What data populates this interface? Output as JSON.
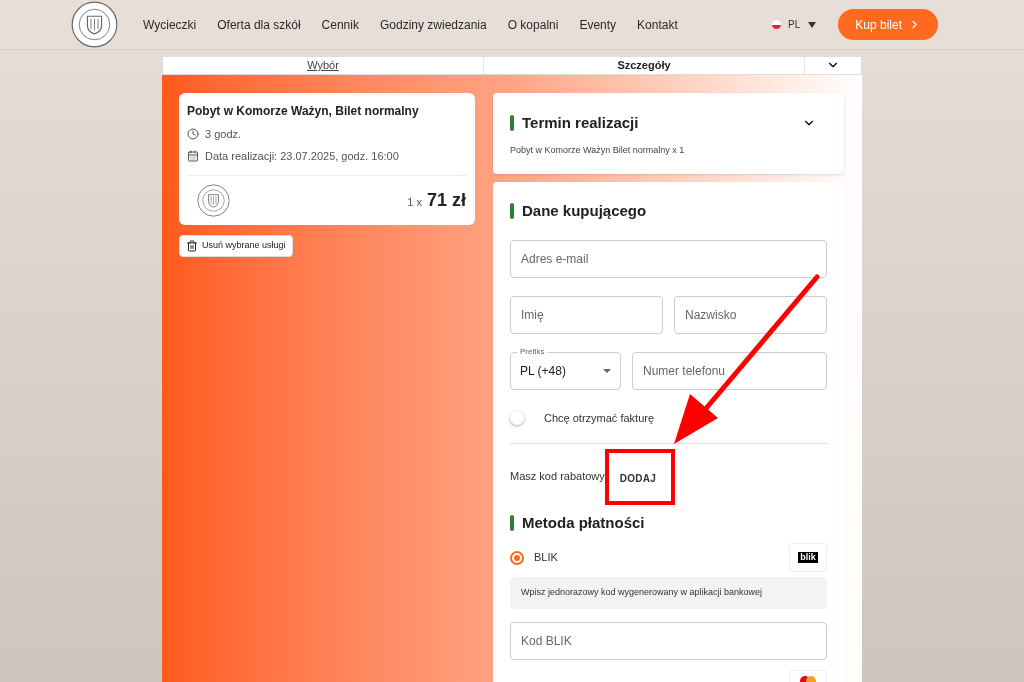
{
  "header": {
    "nav": [
      "Wycieczki",
      "Oferta dla szkół",
      "Cennik",
      "Godziny zwiedzania",
      "O kopalni",
      "Eventy",
      "Kontakt"
    ],
    "language": "PL",
    "cta": "Kup bilet"
  },
  "steps": [
    {
      "label": "Wybór",
      "selected": false
    },
    {
      "label": "Szczegóły",
      "selected": true
    }
  ],
  "cart": {
    "title": "Pobyt w Komorze Ważyn, Bilet normalny",
    "duration": "3 godz.",
    "date": "Data realizacji: 23.07.2025, godz. 16:00",
    "quantity": "1 x",
    "price": "71 zł",
    "remove_button": "Usuń wybrane usługi"
  },
  "term": {
    "title": "Termin realizacji",
    "summary": "Pobyt w Komorze Ważyn Bilet normalny x 1",
    "expanded": false
  },
  "buyer": {
    "title": "Dane kupującego",
    "email": {
      "placeholder": "Adres e-mail"
    },
    "first_name": {
      "placeholder": "Imię"
    },
    "last_name": {
      "placeholder": "Nazwisko"
    },
    "prefix": {
      "label": "Prefiks",
      "value": "PL (+48)"
    },
    "phone": {
      "placeholder": "Numer telefonu"
    },
    "invoice": {
      "label": "Chcę otrzymać fakturę",
      "on": false
    },
    "discount": {
      "label": "Masz kod rabatowy",
      "button": "DODAJ"
    }
  },
  "payment": {
    "title": "Metoda płatności",
    "methods": [
      {
        "label": "BLIK",
        "selected": true,
        "logo": "blik",
        "hint": "Wpisz jednorazowy kod wygenerowany w aplikacji bankowej",
        "code": {
          "placeholder": "Kod BLIK"
        }
      }
    ]
  }
}
